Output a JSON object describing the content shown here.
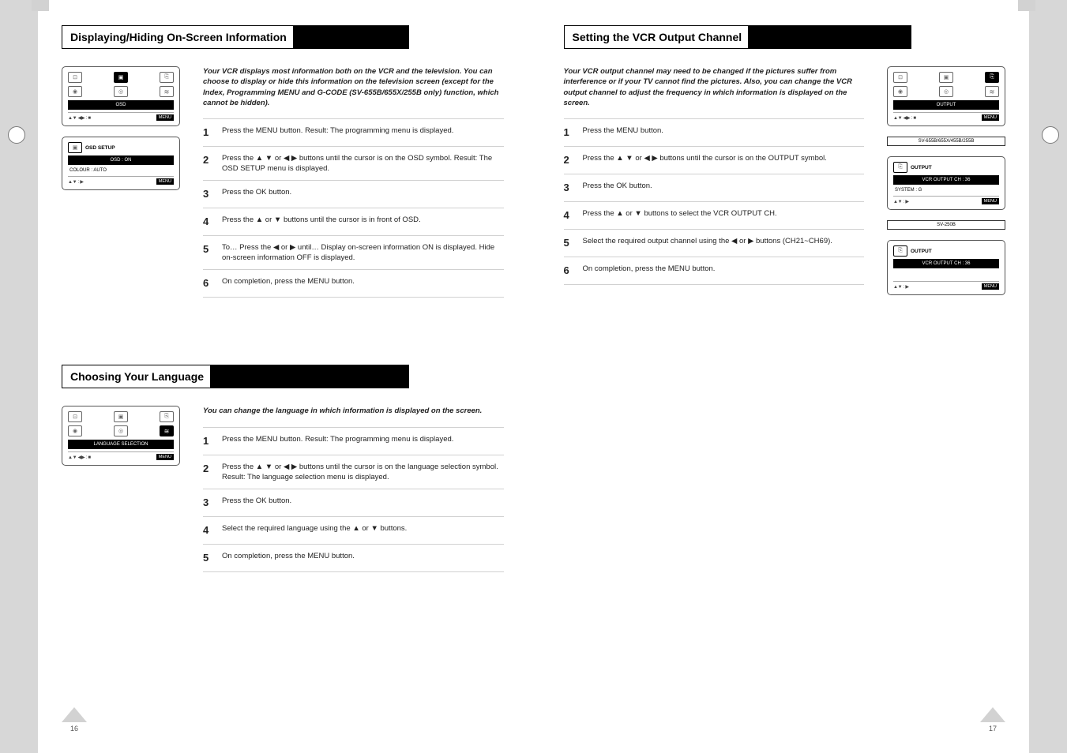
{
  "left_page": {
    "page_number": "16",
    "sections": [
      {
        "title": "Displaying/Hiding On-Screen Information",
        "lead": "Your VCR displays most information both on the VCR and the television.\nYou can choose to display or hide this information on the television screen (except for the Index, Programming MENU and G-CODE    (SV-655B/655X/255B only) function, which cannot be hidden).",
        "steps": [
          {
            "num": "1",
            "body": "Press the MENU button.\nResult: The programming menu is displayed."
          },
          {
            "num": "2",
            "body": "Press the  ▲ ▼  or  ◀ ▶  buttons until the cursor is on the OSD symbol.\nResult: The OSD SETUP menu is displayed."
          },
          {
            "num": "3",
            "body": "Press the OK button."
          },
          {
            "num": "4",
            "body": "Press the  ▲  or  ▼  buttons until the cursor is in front of OSD."
          },
          {
            "num": "5",
            "body": "To…                                         Press the  ◀  or  ▶  until…\nDisplay on-screen information   ON is displayed.\nHide on-screen information         OFF is displayed."
          },
          {
            "num": "6",
            "body": "On completion, press the MENU button."
          }
        ],
        "panels": [
          {
            "type": "grid",
            "highlighted": "osd",
            "footer_keys": "▲▼ ◀▶ : ■",
            "footer_menu": "MENU"
          },
          {
            "type": "osdsetup",
            "title": "OSD SETUP",
            "rows": [
              "OSD          : ON",
              "COLOUR   : AUTO"
            ],
            "footer_keys": "▲▼  : ▶",
            "footer_menu": "MENU"
          }
        ]
      },
      {
        "title": "Choosing Your Language",
        "lead": "You can change the language in which information is displayed on the screen.",
        "steps": [
          {
            "num": "1",
            "body": "Press the MENU button.\nResult: The programming menu is displayed."
          },
          {
            "num": "2",
            "body": "Press the  ▲ ▼  or  ◀ ▶  buttons until the cursor is on the language selection symbol.\nResult: The language selection menu is displayed."
          },
          {
            "num": "3",
            "body": "Press the OK button."
          },
          {
            "num": "4",
            "body": "Select the required language using the  ▲  or  ▼  buttons."
          },
          {
            "num": "5",
            "body": "On completion, press the MENU button."
          }
        ],
        "panels": [
          {
            "type": "grid",
            "highlighted": "lang",
            "footer_keys": "▲▼ ◀▶ : ■",
            "footer_menu": "MENU"
          }
        ]
      }
    ]
  },
  "right_page": {
    "page_number": "17",
    "sections": [
      {
        "title": "Setting the VCR Output Channel",
        "lead": "Your VCR output channel may need to be changed if the pictures suffer from interference or if your TV cannot find the pictures. Also, you can change the VCR output channel to adjust the frequency in which information is displayed on the screen.",
        "steps": [
          {
            "num": "1",
            "body": "Press the MENU button."
          },
          {
            "num": "2",
            "body": "Press the  ▲ ▼  or  ◀ ▶  buttons until the cursor is on the OUTPUT symbol."
          },
          {
            "num": "3",
            "body": "Press the OK button."
          },
          {
            "num": "4",
            "body": "Press the  ▲ or ▼  buttons to select the VCR OUTPUT CH."
          },
          {
            "num": "5",
            "body": "Select the required output channel using the  ◀  or  ▶  buttons (CH21~CH69)."
          },
          {
            "num": "6",
            "body": "On completion, press the MENU button."
          }
        ],
        "panels": [
          {
            "type": "grid",
            "highlighted": "output",
            "footer_keys": "▲▼ ◀▶ : ■",
            "footer_menu": "MENU"
          },
          {
            "type": "out",
            "title": "OUTPUT",
            "rows": [
              "VCR OUTPUT CH  : 36",
              "SYSTEM                 : G"
            ],
            "footer_keys": "▲▼  : ▶",
            "footer_menu": "MENU"
          },
          {
            "type": "out",
            "title": "OUTPUT",
            "rows": [
              "VCR OUTPUT CH  : 36"
            ],
            "footer_keys": "▲▼  : ▶",
            "footer_menu": "MENU"
          }
        ],
        "panel_captions": [
          "",
          "SV-655B/655X/455B/255B",
          "SV-250B"
        ]
      }
    ]
  }
}
